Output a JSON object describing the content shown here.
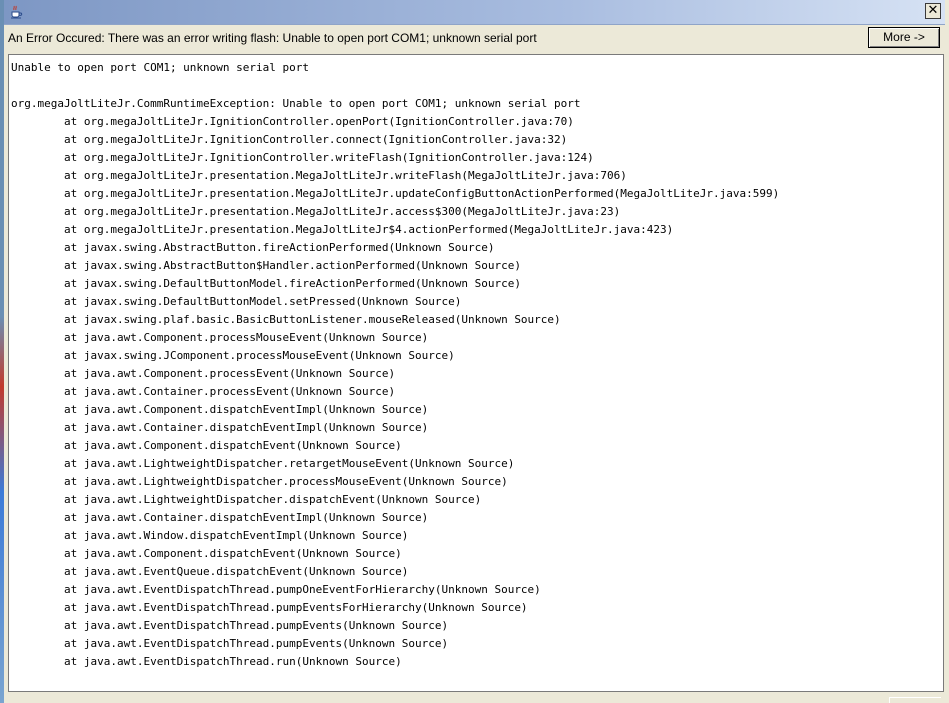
{
  "window": {
    "close_glyph": "✕"
  },
  "error_bar": {
    "message": "An Error Occured: There was an error writing flash: Unable to open port COM1; unknown serial port",
    "more_button": "More ->"
  },
  "trace_lines": [
    "Unable to open port COM1; unknown serial port",
    "",
    "org.megaJoltLiteJr.CommRuntimeException: Unable to open port COM1; unknown serial port",
    "        at org.megaJoltLiteJr.IgnitionController.openPort(IgnitionController.java:70)",
    "        at org.megaJoltLiteJr.IgnitionController.connect(IgnitionController.java:32)",
    "        at org.megaJoltLiteJr.IgnitionController.writeFlash(IgnitionController.java:124)",
    "        at org.megaJoltLiteJr.presentation.MegaJoltLiteJr.writeFlash(MegaJoltLiteJr.java:706)",
    "        at org.megaJoltLiteJr.presentation.MegaJoltLiteJr.updateConfigButtonActionPerformed(MegaJoltLiteJr.java:599)",
    "        at org.megaJoltLiteJr.presentation.MegaJoltLiteJr.access$300(MegaJoltLiteJr.java:23)",
    "        at org.megaJoltLiteJr.presentation.MegaJoltLiteJr$4.actionPerformed(MegaJoltLiteJr.java:423)",
    "        at javax.swing.AbstractButton.fireActionPerformed(Unknown Source)",
    "        at javax.swing.AbstractButton$Handler.actionPerformed(Unknown Source)",
    "        at javax.swing.DefaultButtonModel.fireActionPerformed(Unknown Source)",
    "        at javax.swing.DefaultButtonModel.setPressed(Unknown Source)",
    "        at javax.swing.plaf.basic.BasicButtonListener.mouseReleased(Unknown Source)",
    "        at java.awt.Component.processMouseEvent(Unknown Source)",
    "        at javax.swing.JComponent.processMouseEvent(Unknown Source)",
    "        at java.awt.Component.processEvent(Unknown Source)",
    "        at java.awt.Container.processEvent(Unknown Source)",
    "        at java.awt.Component.dispatchEventImpl(Unknown Source)",
    "        at java.awt.Container.dispatchEventImpl(Unknown Source)",
    "        at java.awt.Component.dispatchEvent(Unknown Source)",
    "        at java.awt.LightweightDispatcher.retargetMouseEvent(Unknown Source)",
    "        at java.awt.LightweightDispatcher.processMouseEvent(Unknown Source)",
    "        at java.awt.LightweightDispatcher.dispatchEvent(Unknown Source)",
    "        at java.awt.Container.dispatchEventImpl(Unknown Source)",
    "        at java.awt.Window.dispatchEventImpl(Unknown Source)",
    "        at java.awt.Component.dispatchEvent(Unknown Source)",
    "        at java.awt.EventQueue.dispatchEvent(Unknown Source)",
    "        at java.awt.EventDispatchThread.pumpOneEventForHierarchy(Unknown Source)",
    "        at java.awt.EventDispatchThread.pumpEventsForHierarchy(Unknown Source)",
    "        at java.awt.EventDispatchThread.pumpEvents(Unknown Source)",
    "        at java.awt.EventDispatchThread.pumpEvents(Unknown Source)",
    "        at java.awt.EventDispatchThread.run(Unknown Source)"
  ]
}
